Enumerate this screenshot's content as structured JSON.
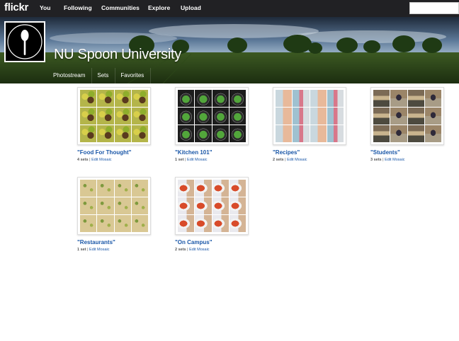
{
  "brand": {
    "logo": "flickr",
    "accent": "#1a57a8",
    "nav_bg": "#212124"
  },
  "nav": {
    "items": [
      "You",
      "Following",
      "Communities",
      "Explore",
      "Upload"
    ]
  },
  "search": {
    "placeholder": ""
  },
  "profile": {
    "name": "NU Spoon University",
    "avatar_icon": "spoon-icon",
    "tabs": [
      "Photostream",
      "Sets",
      "Favorites"
    ]
  },
  "collections": [
    {
      "title": "\"Food For Thought\"",
      "count": "4 sets",
      "edit": "Edit Mosaic",
      "tile_style": "food"
    },
    {
      "title": "\"Kitchen 101\"",
      "count": "1 set",
      "edit": "Edit Mosaic",
      "tile_style": "kitchen"
    },
    {
      "title": "\"Recipes\"",
      "count": "2 sets",
      "edit": "Edit Mosaic",
      "tile_style": "recipes"
    },
    {
      "title": "\"Students\"",
      "count": "3 sets",
      "edit": "Edit Mosaic",
      "tile_style": "students"
    },
    {
      "title": "\"Restaurants\"",
      "count": "1 set",
      "edit": "Edit Mosaic",
      "tile_style": "rest"
    },
    {
      "title": "\"On Campus\"",
      "count": "2 sets",
      "edit": "Edit Mosaic",
      "tile_style": "campus"
    }
  ]
}
